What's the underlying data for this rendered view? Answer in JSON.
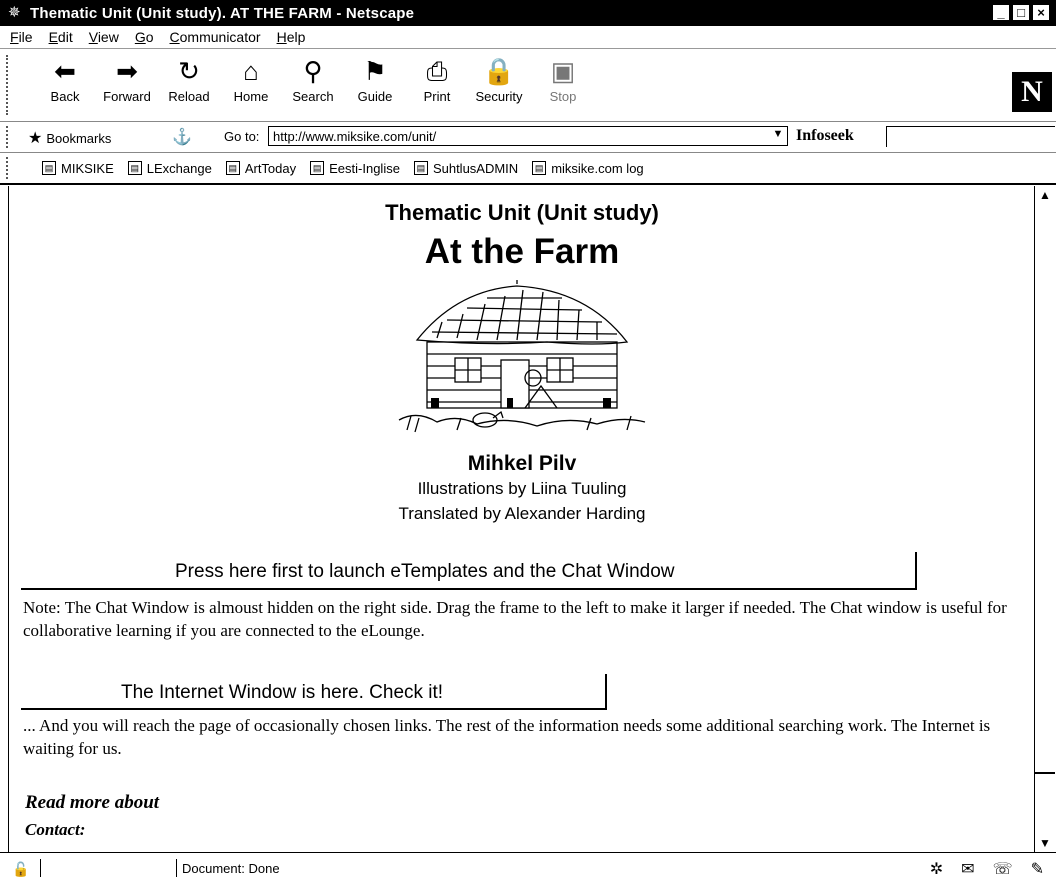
{
  "window": {
    "title": "Thematic Unit (Unit study). AT THE FARM - Netscape",
    "controls": {
      "minimize": "_",
      "maximize": "□",
      "close": "×"
    }
  },
  "menu": [
    "File",
    "Edit",
    "View",
    "Go",
    "Communicator",
    "Help"
  ],
  "toolbar": {
    "buttons": [
      {
        "label": "Back",
        "icon": "back-arrow-icon"
      },
      {
        "label": "Forward",
        "icon": "forward-arrow-icon"
      },
      {
        "label": "Reload",
        "icon": "reload-icon"
      },
      {
        "label": "Home",
        "icon": "home-icon"
      },
      {
        "label": "Search",
        "icon": "search-icon"
      },
      {
        "label": "Guide",
        "icon": "guide-icon"
      },
      {
        "label": "Print",
        "icon": "print-icon"
      },
      {
        "label": "Security",
        "icon": "security-lock-icon"
      },
      {
        "label": "Stop",
        "icon": "stop-icon"
      }
    ],
    "logo": "N"
  },
  "location": {
    "bookmarks_label": "Bookmarks",
    "goto_label": "Go to:",
    "url": "http://www.miksike.com/unit/",
    "search_provider": "Infoseek",
    "search_value": ""
  },
  "links": [
    "MIKSIKE",
    "LExchange",
    "ArtToday",
    "Eesti-Inglise",
    "SuhtlusADMIN",
    "miksike.com log"
  ],
  "page": {
    "subtitle": "Thematic Unit (Unit study)",
    "title": "At the Farm",
    "author": "Mihkel Pilv",
    "illustrations": "Illustrations by Liina Tuuling",
    "translated": "Translated by Alexander Harding",
    "button_templates": "Press here first to launch eTemplates and the Chat Window",
    "note_chat": "Note: The Chat Window is almoust hidden on the right side. Drag the frame to the left to make it larger if needed. The Chat window is useful for collaborative learning if you are connected to the eLounge.",
    "button_internet": "The Internet Window is here. Check it!",
    "note_internet": "... And you will reach the page of occasionally chosen links. The rest of the information needs some additional searching work. The Internet is waiting for us.",
    "read_more": "Read more about",
    "contact": "Contact:"
  },
  "status": {
    "text": "Document: Done"
  }
}
